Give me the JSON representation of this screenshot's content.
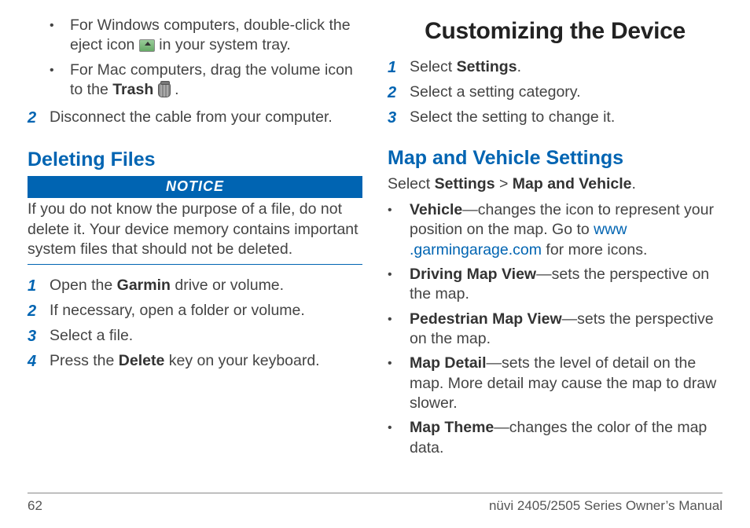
{
  "left": {
    "sub_bullets": [
      {
        "pre": "For Windows computers, double-click the eject icon ",
        "post": " in your system tray.",
        "icon": "eject"
      },
      {
        "pre": "For Mac computers, drag the volume icon to the ",
        "bold": "Trash",
        "post": " .",
        "icon": "trash"
      }
    ],
    "step2_num": "2",
    "step2_text": "Disconnect the cable from your computer.",
    "h2_deleting": "Deleting Files",
    "notice_label": "NOTICE",
    "notice_text": "If you do not know the purpose of a file, do not delete it. Your device memory contains important system files that should not be deleted.",
    "del_steps": [
      {
        "n": "1",
        "pre": "Open the ",
        "b": "Garmin",
        "post": " drive or volume."
      },
      {
        "n": "2",
        "pre": "If necessary, open a folder or volume.",
        "b": "",
        "post": ""
      },
      {
        "n": "3",
        "pre": "Select a file.",
        "b": "",
        "post": ""
      },
      {
        "n": "4",
        "pre": "Press the ",
        "b": "Delete",
        "post": " key on your keyboard."
      }
    ]
  },
  "right": {
    "h1": "Customizing the Device",
    "steps": [
      {
        "n": "1",
        "pre": "Select ",
        "b": "Settings",
        "post": "."
      },
      {
        "n": "2",
        "pre": "Select a setting category.",
        "b": "",
        "post": ""
      },
      {
        "n": "3",
        "pre": "Select the setting to change it.",
        "b": "",
        "post": ""
      }
    ],
    "h2_map": "Map and Vehicle Settings",
    "select_line_pre": "Select ",
    "select_b1": "Settings",
    "select_mid": " > ",
    "select_b2": "Map and Vehicle",
    "select_post": ".",
    "bullets": [
      {
        "b": "Vehicle",
        "t1": "—changes the icon to represent your position on the map. Go to ",
        "link": "www\n.garmingarage.com",
        "t2": " for more icons."
      },
      {
        "b": "Driving Map View",
        "t1": "—sets the perspective on the map.",
        "link": "",
        "t2": ""
      },
      {
        "b": "Pedestrian Map View",
        "t1": "—sets the perspective on the map.",
        "link": "",
        "t2": ""
      },
      {
        "b": "Map Detail",
        "t1": "—sets the level of detail on the map. More detail may cause the map to draw slower.",
        "link": "",
        "t2": ""
      },
      {
        "b": "Map Theme",
        "t1": "—changes the color of the map data.",
        "link": "",
        "t2": ""
      }
    ]
  },
  "footer": {
    "page": "62",
    "title": "nüvi 2405/2505 Series Owner’s Manual"
  }
}
